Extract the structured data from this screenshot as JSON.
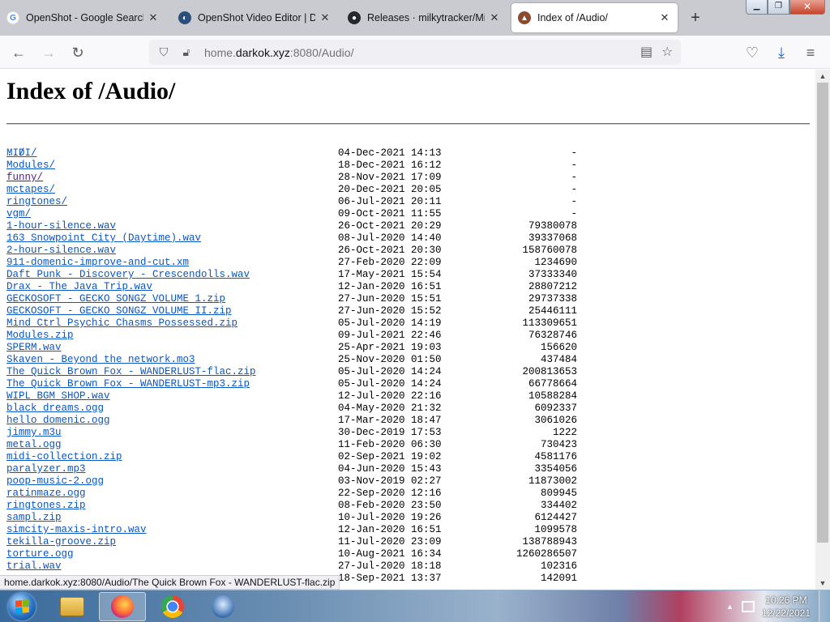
{
  "browser": {
    "tabs": [
      {
        "title": "OpenShot - Google Search",
        "icon": "google-icon",
        "active": false
      },
      {
        "title": "OpenShot Video Editor | Dow",
        "icon": "openshot-icon",
        "active": false
      },
      {
        "title": "Releases · milkytracker/Milk",
        "icon": "github-icon",
        "active": false
      },
      {
        "title": "Index of /Audio/",
        "icon": "site-favicon-icon",
        "active": true
      }
    ],
    "new_tab": "+",
    "url_prefix": "home.",
    "url_domain": "darkok.xyz",
    "url_rest": ":8080/Audio/",
    "status_text": "home.darkok.xyz:8080/Audio/The Quick Brown Fox - WANDERLUST-flac.zip"
  },
  "page": {
    "heading": "Index of /Audio/",
    "parent_link": "../",
    "entries": [
      {
        "name": "MIDI/",
        "date": "04-Dec-2021 14:13",
        "size": "-"
      },
      {
        "name": "Modules/",
        "date": "18-Dec-2021 16:12",
        "size": "-"
      },
      {
        "name": "funny/",
        "date": "28-Nov-2021 17:09",
        "size": "-",
        "visited": true
      },
      {
        "name": "mctapes/",
        "date": "20-Dec-2021 20:05",
        "size": "-"
      },
      {
        "name": "ringtones/",
        "date": "06-Jul-2021 20:11",
        "size": "-"
      },
      {
        "name": "vgm/",
        "date": "09-Oct-2021 11:55",
        "size": "-"
      },
      {
        "name": "1-hour-silence.wav",
        "date": "26-Oct-2021 20:29",
        "size": "79380078"
      },
      {
        "name": "163 Snowpoint City (Daytime).wav",
        "date": "08-Jul-2020 14:40",
        "size": "39337068"
      },
      {
        "name": "2-hour-silence.wav",
        "date": "26-Oct-2021 20:30",
        "size": "158760078"
      },
      {
        "name": "911-domenic-improve-and-cut.xm",
        "date": "27-Feb-2020 22:09",
        "size": "1234690"
      },
      {
        "name": "Daft Punk - Discovery - Crescendolls.wav",
        "date": "17-May-2021 15:54",
        "size": "37333340"
      },
      {
        "name": "Drax - The Java Trip.wav",
        "date": "12-Jan-2020 16:51",
        "size": "28807212"
      },
      {
        "name": "GECKOSOFT - GECKO SONGZ VOLUME 1.zip",
        "date": "27-Jun-2020 15:51",
        "size": "29737338"
      },
      {
        "name": "GECKOSOFT - GECKO SONGZ VOLUME II.zip",
        "date": "27-Jun-2020 15:52",
        "size": "25446111"
      },
      {
        "name": "Mind Ctrl Psychic Chasms Possessed.zip",
        "date": "05-Jul-2020 14:19",
        "size": "113309651"
      },
      {
        "name": "Modules.zip",
        "date": "09-Jul-2021 22:46",
        "size": "76328746"
      },
      {
        "name": "SPERM.wav",
        "date": "25-Apr-2021 19:03",
        "size": "156620"
      },
      {
        "name": "Skaven - Beyond the network.mo3",
        "date": "25-Nov-2020 01:50",
        "size": "437484"
      },
      {
        "name": "The Quick Brown Fox - WANDERLUST-flac.zip",
        "date": "05-Jul-2020 14:24",
        "size": "200813653"
      },
      {
        "name": "The Quick Brown Fox - WANDERLUST-mp3.zip",
        "date": "05-Jul-2020 14:24",
        "size": "66778664"
      },
      {
        "name": "WIPL BGM SHOP.wav",
        "date": "12-Jul-2020 22:16",
        "size": "10588284"
      },
      {
        "name": "black dreams.ogg",
        "date": "04-May-2020 21:32",
        "size": "6092337"
      },
      {
        "name": "hello domenic.ogg",
        "date": "17-Mar-2020 18:47",
        "size": "3061026"
      },
      {
        "name": "jimmy.m3u",
        "date": "30-Dec-2019 17:53",
        "size": "1222"
      },
      {
        "name": "metal.ogg",
        "date": "11-Feb-2020 06:30",
        "size": "730423"
      },
      {
        "name": "midi-collection.zip",
        "date": "02-Sep-2021 19:02",
        "size": "4581176"
      },
      {
        "name": "paralyzer.mp3",
        "date": "04-Jun-2020 15:43",
        "size": "3354056"
      },
      {
        "name": "poop-music-2.ogg",
        "date": "03-Nov-2019 02:27",
        "size": "11873002"
      },
      {
        "name": "ratinmaze.ogg",
        "date": "22-Sep-2020 12:16",
        "size": "809945"
      },
      {
        "name": "ringtones.zip",
        "date": "08-Feb-2020 23:50",
        "size": "334402"
      },
      {
        "name": "sampl.zip",
        "date": "10-Jul-2020 19:26",
        "size": "6124427"
      },
      {
        "name": "simcity-maxis-intro.wav",
        "date": "12-Jan-2020 16:51",
        "size": "1099578"
      },
      {
        "name": "tekilla-groove.zip",
        "date": "11-Jul-2020 23:09",
        "size": "138788943"
      },
      {
        "name": "torture.ogg",
        "date": "10-Aug-2021 16:34",
        "size": "1260286507"
      },
      {
        "name": "trial.wav",
        "date": "27-Jul-2020 18:18",
        "size": "102316"
      },
      {
        "name": "",
        "date": "18-Sep-2021 13:37",
        "size": "142091"
      }
    ]
  },
  "taskbar": {
    "apps": [
      "explorer-icon",
      "firefox-icon",
      "chrome-icon",
      "milkytracker-icon"
    ],
    "time": "10:26 PM",
    "date": "12/22/2021"
  },
  "colors": {
    "link": "#0b55c4",
    "visited_link": "#551a8b",
    "tabbar_bg": "#c9cbd0"
  }
}
